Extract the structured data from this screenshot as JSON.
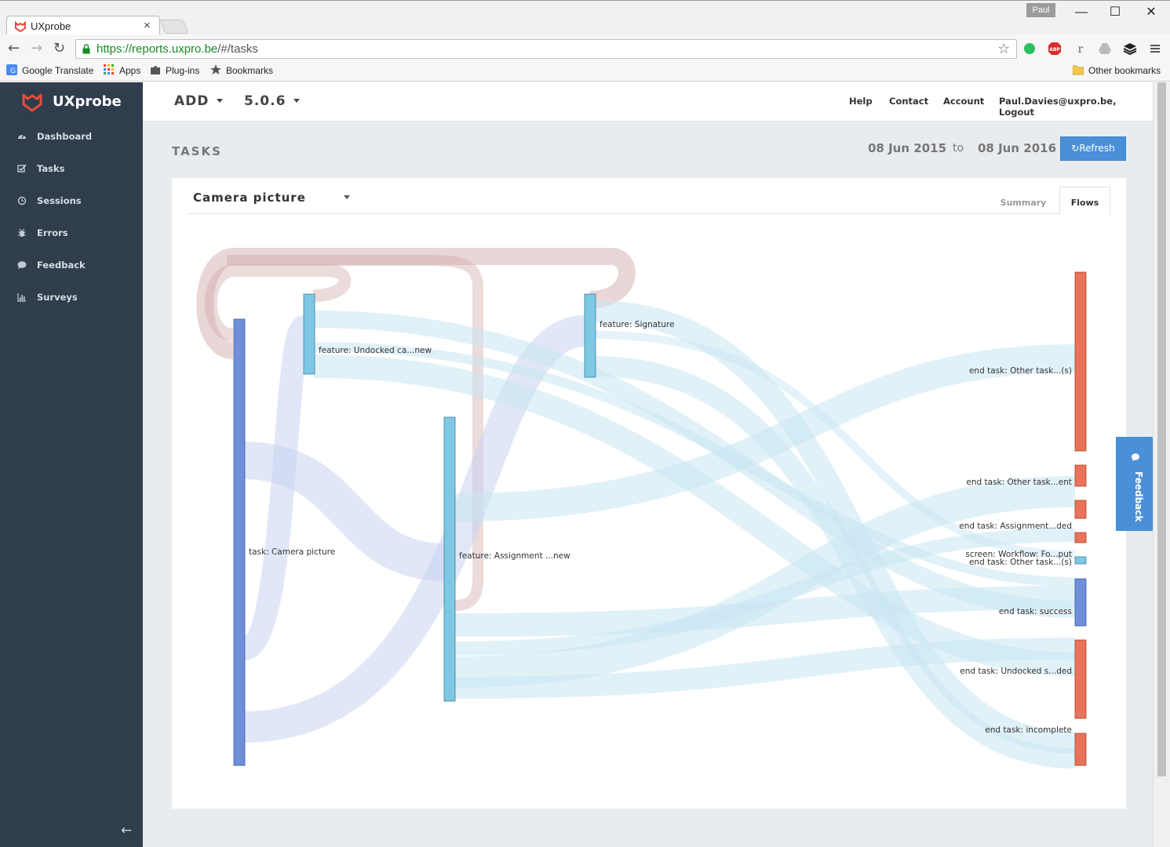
{
  "browser": {
    "tab_title": "UXprobe",
    "profile_name": "Paul",
    "url_scheme_host": "https://reports.uxpro.be",
    "url_path": "/#/tasks",
    "window_controls": {
      "minimize": "—",
      "maximize": "☐",
      "close": "✕"
    },
    "nav": {
      "back": "←",
      "forward": "→",
      "reload": "↻"
    },
    "bookmarks": [
      "Google Translate",
      "Apps",
      "Plug-ins",
      "Bookmarks"
    ],
    "other_bookmarks": "Other bookmarks",
    "extensions": [
      "evernote-icon",
      "adblock-icon",
      "readability-icon",
      "drive-icon",
      "buffer-icon",
      "menu-icon"
    ]
  },
  "app": {
    "brand": "UXprobe",
    "brand_color": "#e84c3d",
    "sidebar": {
      "items": [
        {
          "label": "Dashboard",
          "icon": "dashboard-icon"
        },
        {
          "label": "Tasks",
          "icon": "tasks-icon"
        },
        {
          "label": "Sessions",
          "icon": "sessions-icon"
        },
        {
          "label": "Errors",
          "icon": "errors-icon"
        },
        {
          "label": "Feedback",
          "icon": "feedback-icon"
        },
        {
          "label": "Surveys",
          "icon": "surveys-icon"
        }
      ],
      "collapse_glyph": "←"
    },
    "topnav": {
      "project": "ADD",
      "version": "5.0.6",
      "links": [
        "Help",
        "Contact",
        "Account",
        "Paul.Davies@uxpro.be, Logout"
      ]
    },
    "page": {
      "title": "TASKS",
      "date_from": "08 Jun 2015",
      "date_to_label": "to",
      "date_to": "08 Jun 2016",
      "refresh_label": "Refresh"
    },
    "panel": {
      "task_selected": "Camera picture",
      "tabs": [
        "Summary",
        "Flows"
      ],
      "active_tab": "Flows"
    },
    "feedback_tab": "Feedback"
  },
  "chart_data": {
    "type": "sankey",
    "colors": {
      "task_node": "#6f8fd8",
      "feature_node": "#7ec8e3",
      "end_node": "#e8735a",
      "success_node": "#6f8fd8",
      "screen_node": "#7ec8e3",
      "loop_link": "#cfa6a6",
      "task_link": "#c9d3f0",
      "feature_link": "#c9e6f3"
    },
    "nodes": [
      {
        "id": "task",
        "label": "task: Camera picture",
        "kind": "task"
      },
      {
        "id": "undocked",
        "label": "feature: Undocked ca...new",
        "kind": "feature"
      },
      {
        "id": "assignment",
        "label": "feature: Assignment ...new",
        "kind": "feature"
      },
      {
        "id": "signature",
        "label": "feature: Signature",
        "kind": "feature"
      },
      {
        "id": "end_other_s",
        "label": "end task: Other task...(s)",
        "kind": "end"
      },
      {
        "id": "end_other_ent",
        "label": "end task: Other task...ent",
        "kind": "end"
      },
      {
        "id": "end_assign_ded",
        "label": "end task: Assignment...ded",
        "kind": "end"
      },
      {
        "id": "screen_workflow",
        "label": "screen: Workflow: Fo...put",
        "kind": "screen"
      },
      {
        "id": "end_other_s2",
        "label": "end task: Other task...(s)",
        "kind": "end"
      },
      {
        "id": "end_success",
        "label": "end task: success",
        "kind": "success"
      },
      {
        "id": "end_undocked",
        "label": "end task: Undocked s...ded",
        "kind": "end"
      },
      {
        "id": "end_incomplete",
        "label": "end task: incomplete",
        "kind": "end"
      }
    ]
  }
}
